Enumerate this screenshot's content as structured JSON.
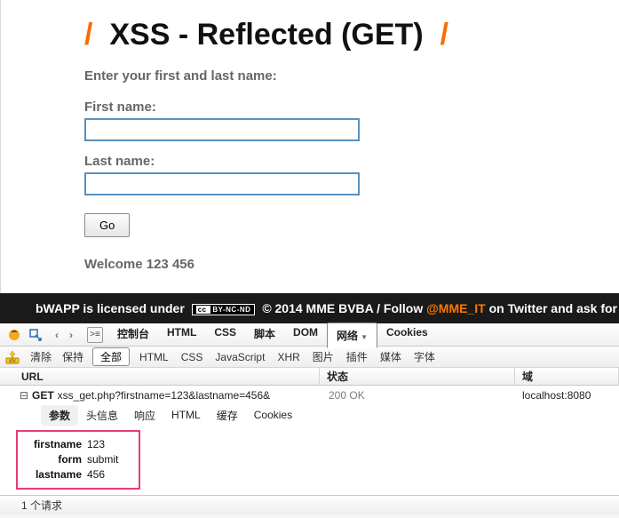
{
  "page": {
    "title_text": "XSS - Reflected (GET)",
    "intro": "Enter your first and last name:",
    "firstname_label": "First name:",
    "lastname_label": "Last name:",
    "go_label": "Go",
    "result": "Welcome 123 456"
  },
  "footer": {
    "prefix": "bWAPP is licensed under ",
    "cc": "BY-NC-ND",
    "mid": " © 2014 MME BVBA / Follow ",
    "twitter": "@MME_IT",
    "suffix": " on Twitter and ask for"
  },
  "devtools": {
    "tabs1": {
      "console": "控制台",
      "html": "HTML",
      "css": "CSS",
      "script": "脚本",
      "dom": "DOM",
      "net": "网络",
      "cookies": "Cookies"
    },
    "row2": {
      "clear": "清除",
      "persist": "保持",
      "all": "全部"
    },
    "filters": {
      "html": "HTML",
      "css": "CSS",
      "js": "JavaScript",
      "xhr": "XHR",
      "img": "图片",
      "plugin": "插件",
      "media": "媒体",
      "font": "字体"
    },
    "gridhead": {
      "url": "URL",
      "status": "状态",
      "domain": "域"
    },
    "request": {
      "toggle": "⊟",
      "method": "GET",
      "url": "xss_get.php?firstname=123&lastname=456&",
      "status": "200 OK",
      "domain": "localhost:8080"
    },
    "subtabs": {
      "params": "参数",
      "headers": "头信息",
      "response": "响应",
      "html": "HTML",
      "cache": "缓存",
      "cookies": "Cookies"
    },
    "params": [
      {
        "k": "firstname",
        "v": "123"
      },
      {
        "k": "form",
        "v": "submit"
      },
      {
        "k": "lastname",
        "v": "456"
      }
    ],
    "statusbar": "1 个请求"
  }
}
